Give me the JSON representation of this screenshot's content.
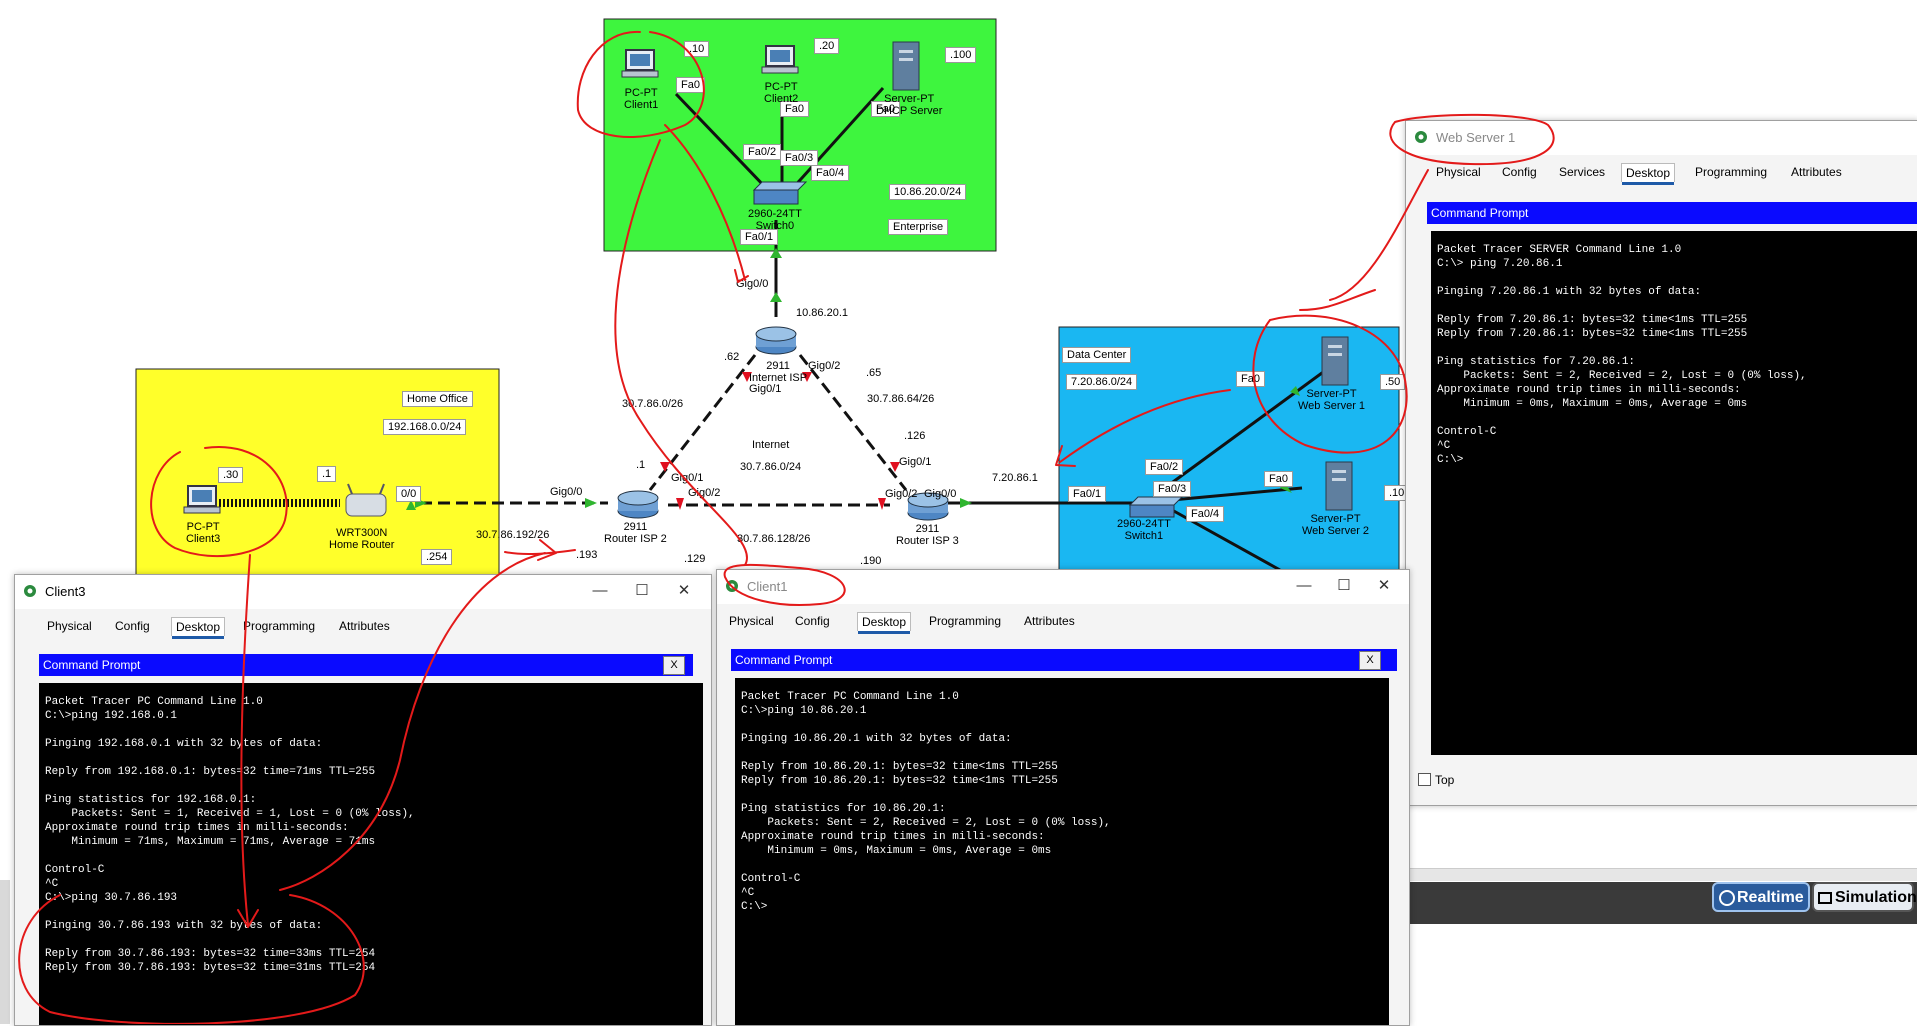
{
  "zones": {
    "enterprise": {
      "name": "Enterprise",
      "network": "10.86.20.0/24",
      "color": "#3ef53e"
    },
    "home_office": {
      "name": "Home Office",
      "network": "192.168.0.0/24",
      "color": "#ffff2a"
    },
    "data_center": {
      "name": "Data Center",
      "network": "7.20.86.0/24",
      "color": "#1ab7f2"
    }
  },
  "devices": {
    "client1": {
      "model": "PC-PT",
      "name": "Client1",
      "host": ".10",
      "port": "Fa0"
    },
    "client2": {
      "model": "PC-PT",
      "name": "Client2",
      "host": ".20",
      "port": "Fa0"
    },
    "dhcp_server": {
      "model": "Server-PT",
      "name": "DHCP Server",
      "host": ".100",
      "port": "Fa0"
    },
    "switch0": {
      "model": "2960-24TT",
      "name": "Switch0",
      "ports": [
        "Fa0/2",
        "Fa0/3",
        "Fa0/4",
        "Fa0/1"
      ]
    },
    "internet_isp": {
      "model": "2911",
      "name": "Internet ISP",
      "ports": [
        "Gig0/0",
        "Gig0/1",
        "Gig0/2"
      ],
      "addr": "10.86.20.1",
      "left_host": ".62",
      "right_host": ".65"
    },
    "internet_cloud": {
      "label": "Internet",
      "network": "30.7.86.0/24",
      "left_net": "30.7.86.0/26",
      "right_net": "30.7.86.64/26"
    },
    "router_isp2": {
      "model": "2911",
      "name": "Router ISP 2",
      "ports": [
        "Gig0/0",
        "Gig0/1",
        "Gig0/2"
      ],
      "host_up": ".1",
      "host_left": ".193",
      "host_right": ".129",
      "net_left": "30.7.86.192/26"
    },
    "router_isp3": {
      "model": "2911",
      "name": "Router ISP 3",
      "ports": [
        "Gig0/1",
        "Gig0/2",
        "Gig0/0"
      ],
      "host_up": ".126",
      "host_left": ".190",
      "addr": "7.20.86.1",
      "net_mid": "30.7.86.128/26"
    },
    "home_router": {
      "model": "WRT300N",
      "name": "Home Router",
      "host": ".1",
      "port": "0/0",
      "wan_host": ".254"
    },
    "client3": {
      "model": "PC-PT",
      "name": "Client3",
      "host": ".30"
    },
    "switch1": {
      "model": "2960-24TT",
      "name": "Switch1",
      "ports": [
        "Fa0/1",
        "Fa0/2",
        "Fa0/3",
        "Fa0/4"
      ]
    },
    "web_server1": {
      "model": "Server-PT",
      "name": "Web Server 1",
      "host": ".50",
      "port": "Fa0"
    },
    "web_server2": {
      "model": "Server-PT",
      "name": "Web Server 2",
      "host": ".10",
      "port": "Fa0"
    }
  },
  "windows": {
    "client3": {
      "title": "Client3",
      "tabs": [
        "Physical",
        "Config",
        "Desktop",
        "Programming",
        "Attributes"
      ],
      "active_tab": "Desktop",
      "cmd_title": "Command Prompt",
      "close_x": "X",
      "terminal": "Packet Tracer PC Command Line 1.0\nC:\\>ping 192.168.0.1\n\nPinging 192.168.0.1 with 32 bytes of data:\n\nReply from 192.168.0.1: bytes=32 time=71ms TTL=255\n\nPing statistics for 192.168.0.1:\n    Packets: Sent = 1, Received = 1, Lost = 0 (0% loss),\nApproximate round trip times in milli-seconds:\n    Minimum = 71ms, Maximum = 71ms, Average = 71ms\n\nControl-C\n^C\nC:\\>ping 30.7.86.193\n\nPinging 30.7.86.193 with 32 bytes of data:\n\nReply from 30.7.86.193: bytes=32 time=33ms TTL=254\nReply from 30.7.86.193: bytes=32 time=31ms TTL=254"
    },
    "client1": {
      "title": "Client1",
      "tabs": [
        "Physical",
        "Config",
        "Desktop",
        "Programming",
        "Attributes"
      ],
      "active_tab": "Desktop",
      "cmd_title": "Command Prompt",
      "close_x": "X",
      "terminal": "Packet Tracer PC Command Line 1.0\nC:\\>ping 10.86.20.1\n\nPinging 10.86.20.1 with 32 bytes of data:\n\nReply from 10.86.20.1: bytes=32 time<1ms TTL=255\nReply from 10.86.20.1: bytes=32 time<1ms TTL=255\n\nPing statistics for 10.86.20.1:\n    Packets: Sent = 2, Received = 2, Lost = 0 (0% loss),\nApproximate round trip times in milli-seconds:\n    Minimum = 0ms, Maximum = 0ms, Average = 0ms\n\nControl-C\n^C\nC:\\>"
    },
    "web_server1": {
      "title": "Web Server 1",
      "tabs": [
        "Physical",
        "Config",
        "Services",
        "Desktop",
        "Programming",
        "Attributes"
      ],
      "active_tab": "Desktop",
      "cmd_title": "Command Prompt",
      "terminal": "Packet Tracer SERVER Command Line 1.0\nC:\\> ping 7.20.86.1\n\nPinging 7.20.86.1 with 32 bytes of data:\n\nReply from 7.20.86.1: bytes=32 time<1ms TTL=255\nReply from 7.20.86.1: bytes=32 time<1ms TTL=255\n\nPing statistics for 7.20.86.1:\n    Packets: Sent = 2, Received = 2, Lost = 0 (0% loss),\nApproximate round trip times in milli-seconds:\n    Minimum = 0ms, Maximum = 0ms, Average = 0ms\n\nControl-C\n^C\nC:\\>",
      "top_checkbox": "Top"
    }
  },
  "mode_bar": {
    "realtime": "Realtime",
    "simulation": "Simulation"
  },
  "window_controls": {
    "minimize": "—",
    "maximize": "☐",
    "close": "✕"
  },
  "colors": {
    "annotation": "#e31a1a",
    "cmd_bar": "#0a0aff",
    "link": "#111111",
    "link_up": "#2fb52f",
    "link_down": "#e01020"
  }
}
